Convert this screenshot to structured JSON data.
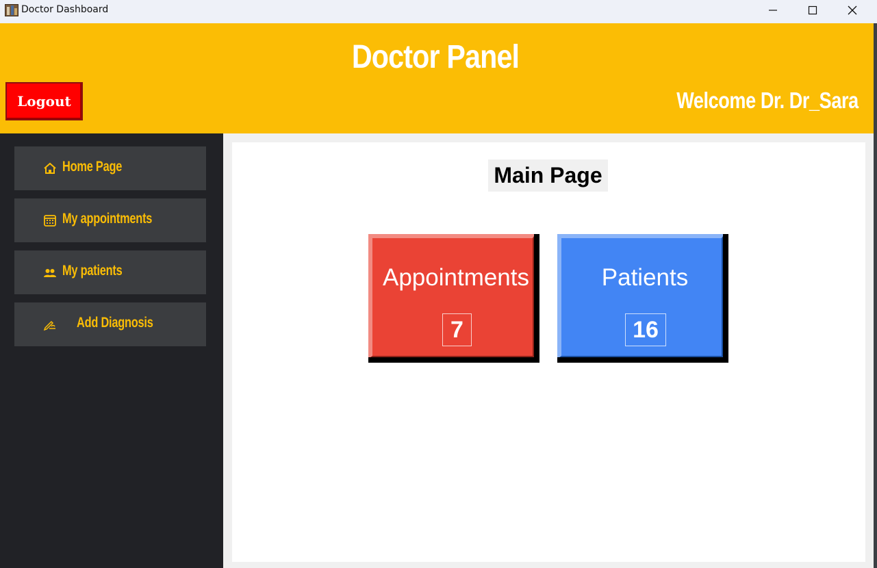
{
  "window": {
    "title": "Doctor Dashboard"
  },
  "header": {
    "title": "Doctor Panel",
    "logout_label": "Logout",
    "welcome_text": "Welcome Dr. Dr_Sara",
    "background_color": "#fbbd05"
  },
  "sidebar": {
    "items": [
      {
        "label": "Home Page",
        "icon": "home-icon"
      },
      {
        "label": "My appointments",
        "icon": "calendar-icon"
      },
      {
        "label": "My patients",
        "icon": "users-icon"
      },
      {
        "label": "Add Diagnosis",
        "icon": "writing-hand-icon"
      }
    ],
    "accent_color": "#fbbd05"
  },
  "main": {
    "title": "Main Page",
    "cards": [
      {
        "label": "Appointments",
        "count": "7",
        "color": "#ea4335"
      },
      {
        "label": "Patients",
        "count": "16",
        "color": "#4285f4"
      }
    ]
  }
}
